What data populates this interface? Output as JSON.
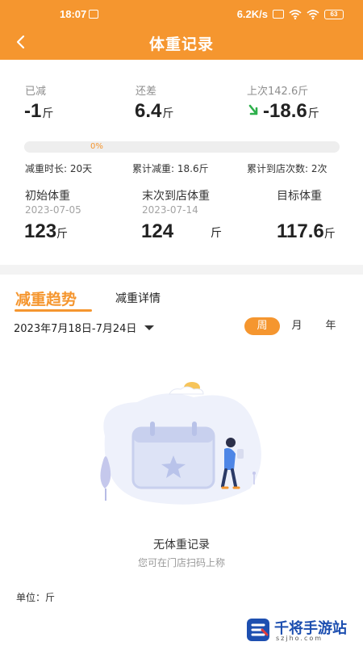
{
  "status": {
    "time": "18:07",
    "network": "6.2K/s",
    "battery": "63"
  },
  "header": {
    "title": "体重记录"
  },
  "summary": {
    "lost_label": "已减",
    "lost_value": "-1",
    "remaining_label": "还差",
    "remaining_value": "6.4",
    "last_label": "上次142.6斤",
    "last_value": "-18.6",
    "unit": "斤"
  },
  "progress": {
    "percent": 0,
    "text": "0%"
  },
  "meta": {
    "duration": "减重时长: 20天",
    "total": "累计减重: 18.6斤",
    "visits": "累计到店次数: 2次"
  },
  "weights": {
    "initial_label": "初始体重",
    "initial_date": "2023-07-05",
    "initial_value": "123",
    "last_label": "末次到店体重",
    "last_date": "2023-07-14",
    "last_value": "124",
    "target_label": "目标体重",
    "target_value": "117.6",
    "unit": "斤"
  },
  "tabs": {
    "trend": "减重趋势",
    "detail": "减重详情"
  },
  "date_range": "2023年7月18日-7月24日",
  "period": {
    "week": "周",
    "month": "月",
    "year": "年"
  },
  "empty": {
    "title": "无体重记录",
    "subtitle": "您可在门店扫码上称"
  },
  "unit_row": "单位：斤",
  "watermark": {
    "title": "千将手游站",
    "sub": "szjho.com"
  },
  "colors": {
    "accent": "#f5962f",
    "arrow": "#2db04b"
  }
}
